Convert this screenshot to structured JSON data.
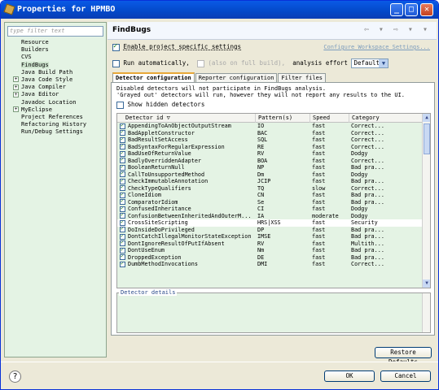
{
  "window": {
    "title": "Properties for HPMBO",
    "min": "_",
    "max": "□",
    "close": "✕"
  },
  "left": {
    "filter_placeholder": "type filter text",
    "tree": [
      {
        "label": "Resource",
        "expandable": false,
        "selected": false
      },
      {
        "label": "Builders",
        "expandable": false,
        "selected": false
      },
      {
        "label": "CVS",
        "expandable": false,
        "selected": false
      },
      {
        "label": "FindBugs",
        "expandable": false,
        "selected": true
      },
      {
        "label": "Java Build Path",
        "expandable": false,
        "selected": false
      },
      {
        "label": "Java Code Style",
        "expandable": true,
        "selected": false
      },
      {
        "label": "Java Compiler",
        "expandable": true,
        "selected": false
      },
      {
        "label": "Java Editor",
        "expandable": true,
        "selected": false
      },
      {
        "label": "Javadoc Location",
        "expandable": false,
        "selected": false
      },
      {
        "label": "MyEclipse",
        "expandable": true,
        "selected": false
      },
      {
        "label": "Project References",
        "expandable": false,
        "selected": false
      },
      {
        "label": "Refactoring History",
        "expandable": false,
        "selected": false
      },
      {
        "label": "Run/Debug Settings",
        "expandable": false,
        "selected": false
      }
    ]
  },
  "header": {
    "title": "FindBugs",
    "nav": "⇦ ▾ ⇨ ▾ ▾"
  },
  "project_specific": {
    "label": "Enable project specific settings",
    "checked": true
  },
  "configure_link": "Configure Workspace Settings...",
  "run_auto": {
    "label": "Run automatically,",
    "also_label": "(also on full build),",
    "effort_label": "analysis effort",
    "effort_value": "Default"
  },
  "tabs": [
    "Detector configuration",
    "Reporter configuration",
    "Filter files"
  ],
  "info_lines": [
    "Disabled detectors will not participate in FindBugs analysis.",
    "'Grayed out' detectors will run, however they will not report any results to the UI."
  ],
  "show_hidden": "Show hidden detectors",
  "columns": [
    "Detector id ▽",
    "Pattern(s)",
    "Speed",
    "Category"
  ],
  "rows": [
    [
      "AppendingToAnObjectOutputStream",
      "IO",
      "fast",
      "Correct..."
    ],
    [
      "BadAppletConstructor",
      "BAC",
      "fast",
      "Correct..."
    ],
    [
      "BadResultSetAccess",
      "SQL",
      "fast",
      "Correct..."
    ],
    [
      "BadSyntaxForRegularExpression",
      "RE",
      "fast",
      "Correct..."
    ],
    [
      "BadUseOfReturnValue",
      "RV",
      "fast",
      "Dodgy"
    ],
    [
      "BadlyOverriddenAdapter",
      "BOA",
      "fast",
      "Correct..."
    ],
    [
      "BooleanReturnNull",
      "NP",
      "fast",
      "Bad pra..."
    ],
    [
      "CallToUnsupportedMethod",
      "Dm",
      "fast",
      "Dodgy"
    ],
    [
      "CheckImmutableAnnotation",
      "JCIP",
      "fast",
      "Bad pra..."
    ],
    [
      "CheckTypeQualifiers",
      "TQ",
      "slow",
      "Correct..."
    ],
    [
      "CloneIdiom",
      "CN",
      "fast",
      "Bad pra..."
    ],
    [
      "ComparatorIdiom",
      "Se",
      "fast",
      "Bad pra..."
    ],
    [
      "ConfusedInheritance",
      "CI",
      "fast",
      "Dodgy"
    ],
    [
      "ConfusionBetweenInheritedAndOuterM...",
      "IA",
      "moderate",
      "Dodgy"
    ],
    [
      "CrossSiteScripting",
      "HRS|XSS",
      "fast",
      "Security"
    ],
    [
      "DoInsideDoPrivileged",
      "DP",
      "fast",
      "Bad pra..."
    ],
    [
      "DontCatchIllegalMonitorStateException",
      "IMSE",
      "fast",
      "Bad pra..."
    ],
    [
      "DontIgnoreResultOfPutIfAbsent",
      "RV",
      "fast",
      "Multith..."
    ],
    [
      "DontUseEnum",
      "Nm",
      "fast",
      "Bad pra..."
    ],
    [
      "DroppedException",
      "DE",
      "fast",
      "Bad pra..."
    ],
    [
      "DumbMethodInvocations",
      "DMI",
      "fast",
      "Correct..."
    ]
  ],
  "highlight_row": 14,
  "details_label": "Detector details",
  "restore_defaults": "Restore Defaults",
  "ok": "OK",
  "cancel": "Cancel",
  "help": "?"
}
